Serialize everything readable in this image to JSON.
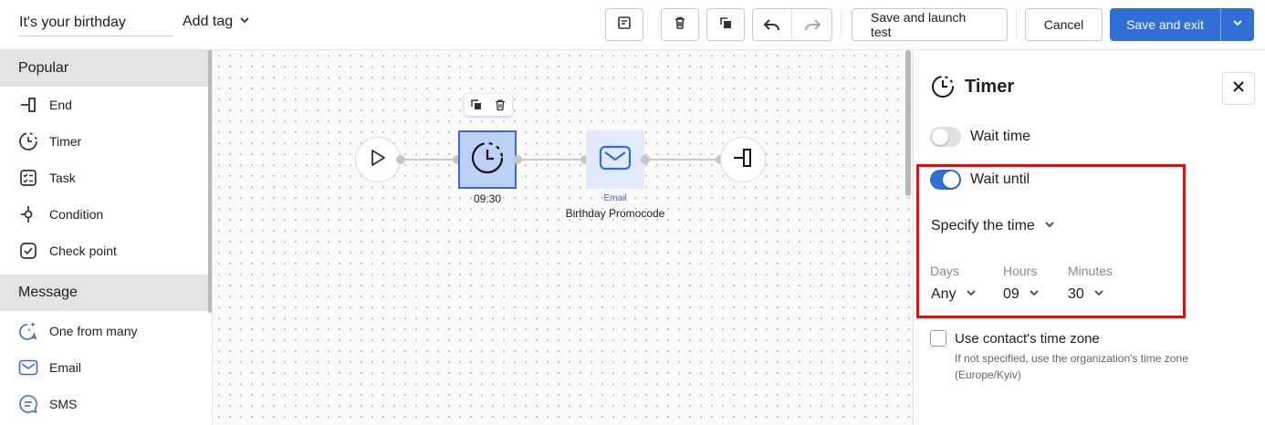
{
  "header": {
    "name_value": "It's your birthday",
    "add_tag_label": "Add tag",
    "save_launch_label": "Save and launch test",
    "cancel_label": "Cancel",
    "save_exit_label": "Save and exit"
  },
  "sidebar": {
    "sections": [
      {
        "title": "Popular",
        "items": [
          {
            "label": "End",
            "icon": "end-icon"
          },
          {
            "label": "Timer",
            "icon": "timer-icon"
          },
          {
            "label": "Task",
            "icon": "task-icon"
          },
          {
            "label": "Condition",
            "icon": "condition-icon"
          },
          {
            "label": "Check point",
            "icon": "check-point-icon"
          }
        ]
      },
      {
        "title": "Message",
        "items": [
          {
            "label": "One from many",
            "icon": "one-from-many-icon"
          },
          {
            "label": "Email",
            "icon": "email-icon"
          },
          {
            "label": "SMS",
            "icon": "sms-icon"
          }
        ]
      }
    ]
  },
  "canvas": {
    "timer_node_label": "09:30",
    "email_node_type": "Email",
    "email_node_name": "Birthday Promocode"
  },
  "panel": {
    "title": "Timer",
    "wait_time_label": "Wait time",
    "wait_until_label": "Wait until",
    "specify_label": "Specify the time",
    "days_label": "Days",
    "days_value": "Any",
    "hours_label": "Hours",
    "hours_value": "09",
    "minutes_label": "Minutes",
    "minutes_value": "30",
    "timezone_label": "Use contact's time zone",
    "timezone_hint": "If not specified, use the organization's time zone (Europe/Kyiv)"
  },
  "colors": {
    "accent": "#2f6fd6",
    "highlight": "#e01010",
    "node_selected": "#bcd1f5"
  }
}
